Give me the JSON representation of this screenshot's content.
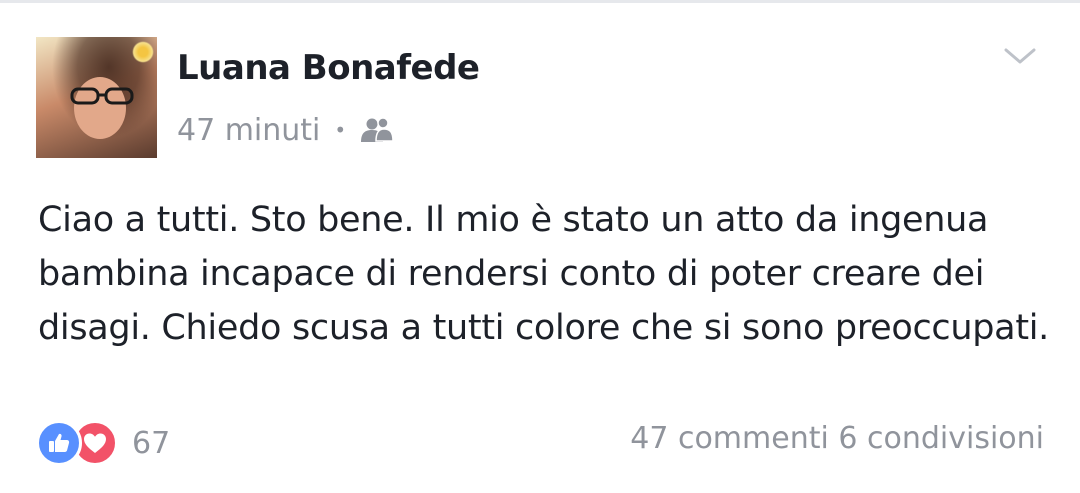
{
  "post": {
    "author": "Luana Bonafede",
    "time": "47 minuti",
    "separator": "•",
    "audience_icon": "friends-icon",
    "text": "Ciao a tutti. Sto bene. Il mio è stato un atto da ingenua bambina incapace di rendersi conto di poter creare dei disagi. Chiedo scusa a tutti colore che si sono preoccupati."
  },
  "reactions": {
    "icons": [
      "like-icon",
      "love-icon"
    ],
    "count": "67"
  },
  "stats": {
    "comments": "47 commenti",
    "shares": "6 condivisioni"
  },
  "colors": {
    "like": "#5890ff",
    "love": "#f25268",
    "text": "#1d2129",
    "meta": "#90949c"
  }
}
